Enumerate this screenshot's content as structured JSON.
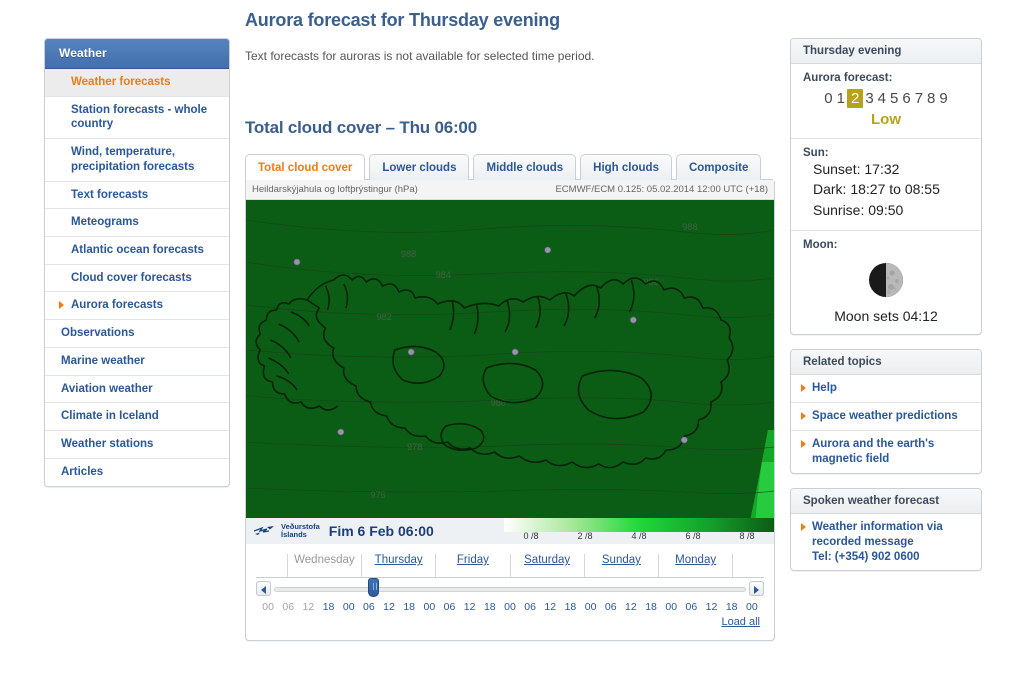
{
  "sidebar": {
    "header": "Weather",
    "items": [
      {
        "label": "Weather forecasts",
        "state": "current"
      },
      {
        "label": "Station forecasts - whole country",
        "state": "sub"
      },
      {
        "label": "Wind, temperature, precipitation forecasts",
        "state": "sub"
      },
      {
        "label": "Text forecasts",
        "state": "sub"
      },
      {
        "label": "Meteograms",
        "state": "sub"
      },
      {
        "label": "Atlantic ocean forecasts",
        "state": "sub"
      },
      {
        "label": "Cloud cover forecasts",
        "state": "sub"
      },
      {
        "label": "Aurora forecasts",
        "state": "selected"
      },
      {
        "label": "Observations",
        "state": "group"
      },
      {
        "label": "Marine weather",
        "state": "group"
      },
      {
        "label": "Aviation weather",
        "state": "group"
      },
      {
        "label": "Climate in Iceland",
        "state": "group"
      },
      {
        "label": "Weather stations",
        "state": "group"
      },
      {
        "label": "Articles",
        "state": "group"
      }
    ]
  },
  "main": {
    "page_title": "Aurora forecast for Thursday evening",
    "intro_text": "Text forecasts for auroras is not available for selected time period.",
    "section_title": "Total cloud cover – Thu 06:00",
    "tabs": [
      {
        "label": "Total cloud cover",
        "active": true
      },
      {
        "label": "Lower clouds",
        "active": false
      },
      {
        "label": "Middle clouds",
        "active": false
      },
      {
        "label": "High clouds",
        "active": false
      },
      {
        "label": "Composite",
        "active": false
      }
    ],
    "map": {
      "caption_left": "Heildarskýjahula og loftþrýstingur (hPa)",
      "caption_right": "ECMWF/ECM 0.125: 05.02.2014 12:00 UTC (+18)",
      "isobar_labels": [
        "988",
        "988",
        "984",
        "986",
        "982",
        "980",
        "978",
        "976"
      ],
      "brand_line1": "Veðurstofa",
      "brand_line2": "Íslands",
      "timestamp": "Fim 6 Feb 06:00"
    },
    "legend": {
      "ticks": [
        "0 /8",
        "2 /8",
        "4 /8",
        "6 /8",
        "8 /8"
      ],
      "colors": [
        "#ffffff",
        "#a8e89a",
        "#1fd83a",
        "#15a32b",
        "#0b5d15"
      ]
    },
    "days": [
      {
        "label": "Wednesday",
        "past": true
      },
      {
        "label": "Thursday",
        "past": false
      },
      {
        "label": "Friday",
        "past": false
      },
      {
        "label": "Saturday",
        "past": false
      },
      {
        "label": "Sunday",
        "past": false
      },
      {
        "label": "Monday",
        "past": false
      }
    ],
    "hours": [
      {
        "t": "00",
        "past": true
      },
      {
        "t": "06",
        "past": true
      },
      {
        "t": "12",
        "past": true
      },
      {
        "t": "18",
        "past": false
      },
      {
        "t": "00",
        "past": false
      },
      {
        "t": "06",
        "past": false
      },
      {
        "t": "12",
        "past": false
      },
      {
        "t": "18",
        "past": false
      },
      {
        "t": "00",
        "past": false
      },
      {
        "t": "06",
        "past": false
      },
      {
        "t": "12",
        "past": false
      },
      {
        "t": "18",
        "past": false
      },
      {
        "t": "00",
        "past": false
      },
      {
        "t": "06",
        "past": false
      },
      {
        "t": "12",
        "past": false
      },
      {
        "t": "18",
        "past": false
      },
      {
        "t": "00",
        "past": false
      },
      {
        "t": "06",
        "past": false
      },
      {
        "t": "12",
        "past": false
      },
      {
        "t": "18",
        "past": false
      },
      {
        "t": "00",
        "past": false
      },
      {
        "t": "06",
        "past": false
      },
      {
        "t": "12",
        "past": false
      },
      {
        "t": "18",
        "past": false
      },
      {
        "t": "00",
        "past": false
      }
    ],
    "load_all": "Load all"
  },
  "right": {
    "forecast_box": {
      "header": "Thursday evening",
      "aurora_label": "Aurora forecast:",
      "scale": [
        "0",
        "1",
        "2",
        "3",
        "4",
        "5",
        "6",
        "7",
        "8",
        "9"
      ],
      "selected_value": "2",
      "level_text": "Low",
      "level_color": "#b8a318",
      "sun_label": "Sun:",
      "sunset": "Sunset: 17:32",
      "dark": "Dark: 18:27 to 08:55",
      "sunrise": "Sunrise: 09:50",
      "moon_label": "Moon:",
      "moon_text": "Moon sets 04:12",
      "moon_phase": "first-quarter"
    },
    "related": {
      "header": "Related topics",
      "links": [
        "Help",
        "Space weather predictions",
        "Aurora and the earth's magnetic field"
      ]
    },
    "spoken": {
      "header": "Spoken weather forecast",
      "links": [
        "Weather information via recorded message Tel: (+354) 902 0600"
      ],
      "link_line1": "Weather information via",
      "link_line2": "recorded message",
      "link_line3": "Tel: (+354) 902 0600"
    }
  }
}
